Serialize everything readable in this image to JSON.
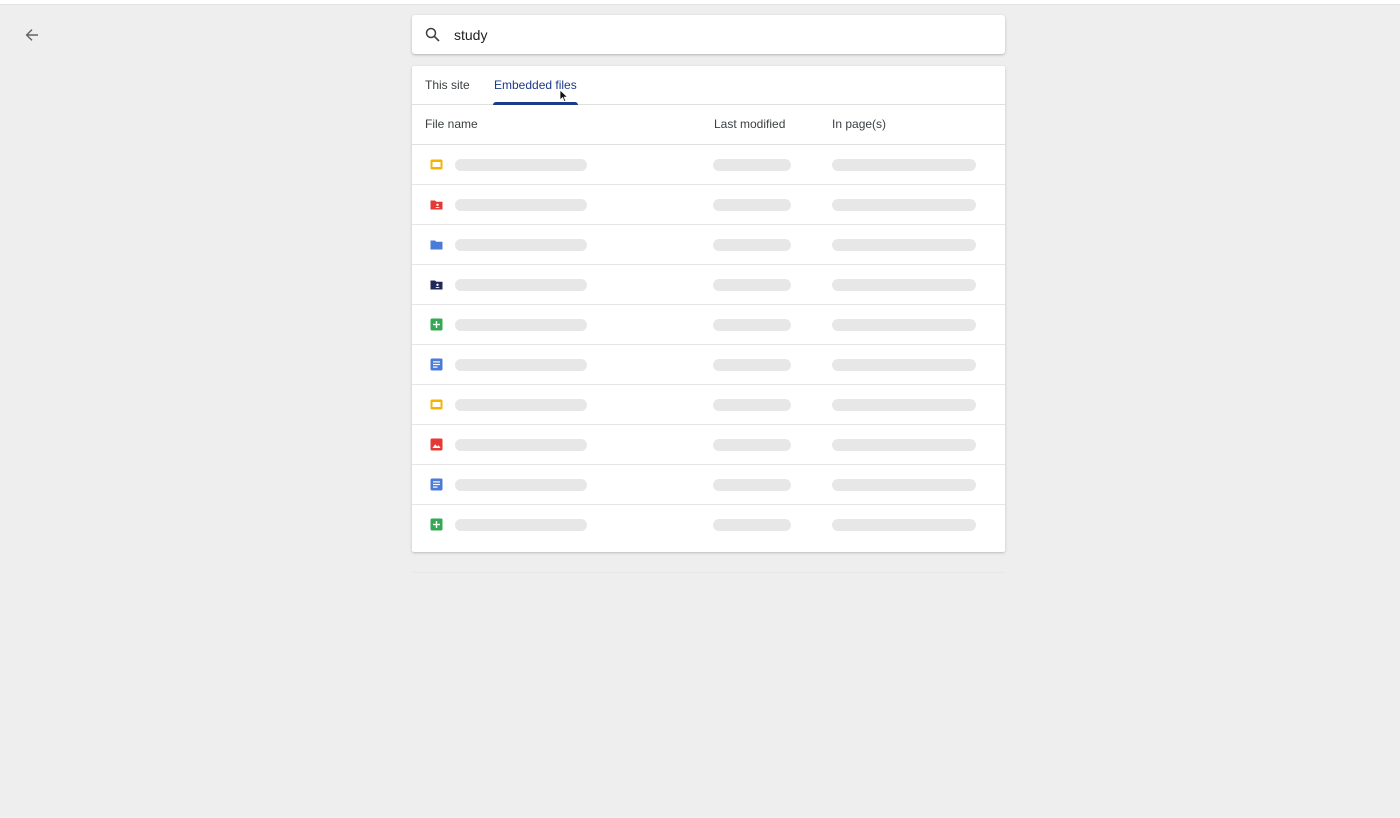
{
  "search": {
    "query": "study"
  },
  "tabs": [
    {
      "label": "This site",
      "active": false
    },
    {
      "label": "Embedded files",
      "active": true
    }
  ],
  "table": {
    "columns": {
      "file_name": "File name",
      "last_modified": "Last modified",
      "in_pages": "In page(s)"
    },
    "rows": [
      {
        "icon": "slides-icon",
        "color": "#f4b400"
      },
      {
        "icon": "shared-folder-icon",
        "color": "#e53935"
      },
      {
        "icon": "folder-icon",
        "color": "#4a7bd8"
      },
      {
        "icon": "shared-folder-icon",
        "color": "#1f2a5a"
      },
      {
        "icon": "sheets-icon",
        "color": "#34a853"
      },
      {
        "icon": "docs-icon",
        "color": "#4a7bd8"
      },
      {
        "icon": "slides-icon",
        "color": "#f4b400"
      },
      {
        "icon": "image-icon",
        "color": "#e53935"
      },
      {
        "icon": "docs-icon",
        "color": "#4a7bd8"
      },
      {
        "icon": "sheets-icon",
        "color": "#34a853"
      }
    ]
  },
  "colors": {
    "background": "#eeeeee",
    "accent": "#1a3a8a",
    "skeleton": "#e7e7e7"
  }
}
